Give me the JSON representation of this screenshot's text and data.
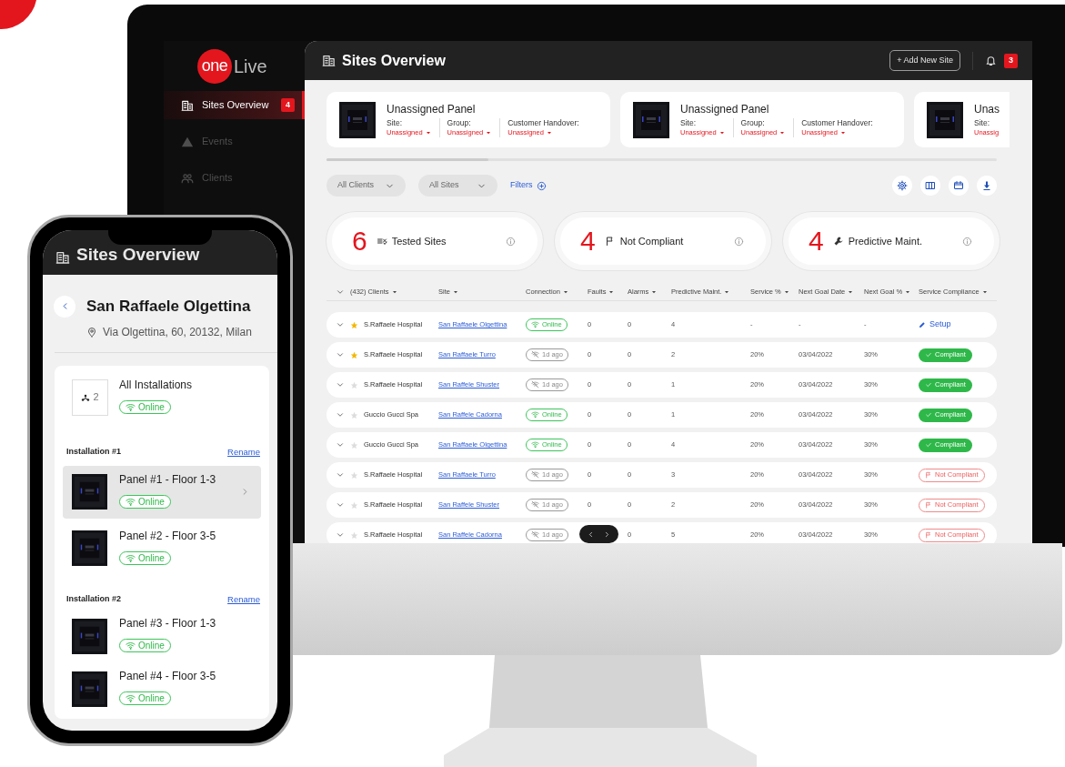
{
  "brand": {
    "logo_badge": "one",
    "logo_text": "Live"
  },
  "sidebar": {
    "items": [
      {
        "label": "Sites Overview",
        "badge": "4",
        "selected": true
      },
      {
        "label": "Events",
        "selected": false
      },
      {
        "label": "Clients",
        "selected": false
      }
    ]
  },
  "header": {
    "title": "Sites Overview",
    "add_button": "+ Add New Site",
    "notification_count": "3"
  },
  "panels": [
    {
      "title": "Unassigned Panel",
      "fields": [
        {
          "label": "Site:",
          "value": "Unassigned",
          "menu": true
        },
        {
          "label": "Group:",
          "value": "Unassigned",
          "menu": true
        },
        {
          "label": "Customer Handover:",
          "value": "Unassigned",
          "menu": true
        }
      ]
    },
    {
      "title": "Unassigned Panel",
      "fields": [
        {
          "label": "Site:",
          "value": "Unassigned",
          "menu": true
        },
        {
          "label": "Group:",
          "value": "Unassigned",
          "menu": true
        },
        {
          "label": "Customer Handover:",
          "value": "Unassigned",
          "menu": true
        }
      ]
    },
    {
      "title": "Unas",
      "fields": [
        {
          "label": "Site:",
          "value": "Unassig",
          "menu": false
        }
      ]
    }
  ],
  "filters": {
    "dropdowns": [
      "All Clients",
      "All Sites"
    ],
    "filters_link": "Filters"
  },
  "stats": [
    {
      "value": "6",
      "label": "Tested Sites",
      "kind": "tested"
    },
    {
      "value": "4",
      "label": "Not Compliant",
      "kind": "flag"
    },
    {
      "value": "4",
      "label": "Predictive Maint.",
      "kind": "wrench"
    }
  ],
  "table": {
    "columns": [
      "(432) Clients",
      "Site",
      "Connection",
      "Faults",
      "Alarms",
      "Predictive Maint.",
      "Service %",
      "Next Goal Date",
      "Next Goal %",
      "Service Compliance"
    ],
    "rows": [
      {
        "starred": true,
        "client": "S.Raffaele Hospital",
        "site": "San Raffaele Olgettina",
        "connection": {
          "online": true,
          "text": "Online"
        },
        "faults": "0",
        "alarms": "0",
        "predictive": "4",
        "service": "-",
        "goal_date": "-",
        "goal_pct": "-",
        "compliance": {
          "kind": "setup",
          "text": "Setup"
        }
      },
      {
        "starred": true,
        "client": "S.Raffaele Hospital",
        "site": "San Raffaele Turro",
        "connection": {
          "online": false,
          "text": "1d ago"
        },
        "faults": "0",
        "alarms": "0",
        "predictive": "2",
        "service": "20%",
        "goal_date": "03/04/2022",
        "goal_pct": "30%",
        "compliance": {
          "kind": "compliant",
          "text": "Compliant"
        }
      },
      {
        "starred": false,
        "client": "S.Raffaele Hospital",
        "site": "San Raffele Shuster",
        "connection": {
          "online": false,
          "text": "1d ago"
        },
        "faults": "0",
        "alarms": "0",
        "predictive": "1",
        "service": "20%",
        "goal_date": "03/04/2022",
        "goal_pct": "30%",
        "compliance": {
          "kind": "compliant",
          "text": "Compliant"
        }
      },
      {
        "starred": false,
        "client": "Guccio Gucci Spa",
        "site": "San Raffele Cadorna",
        "connection": {
          "online": true,
          "text": "Online"
        },
        "faults": "0",
        "alarms": "0",
        "predictive": "1",
        "service": "20%",
        "goal_date": "03/04/2022",
        "goal_pct": "30%",
        "compliance": {
          "kind": "compliant",
          "text": "Compliant"
        }
      },
      {
        "starred": false,
        "client": "Guccio Gucci Spa",
        "site": "San Raffaele Olgettina",
        "connection": {
          "online": true,
          "text": "Online"
        },
        "faults": "0",
        "alarms": "0",
        "predictive": "4",
        "service": "20%",
        "goal_date": "03/04/2022",
        "goal_pct": "30%",
        "compliance": {
          "kind": "compliant",
          "text": "Compliant"
        }
      },
      {
        "starred": false,
        "client": "S.Raffaele Hospital",
        "site": "San Raffaele Turro",
        "connection": {
          "online": false,
          "text": "1d ago"
        },
        "faults": "0",
        "alarms": "0",
        "predictive": "3",
        "service": "20%",
        "goal_date": "03/04/2022",
        "goal_pct": "30%",
        "compliance": {
          "kind": "not_compliant",
          "text": "Not Compliant"
        }
      },
      {
        "starred": false,
        "client": "S.Raffaele Hospital",
        "site": "San Raffele Shuster",
        "connection": {
          "online": false,
          "text": "1d ago"
        },
        "faults": "0",
        "alarms": "0",
        "predictive": "2",
        "service": "20%",
        "goal_date": "03/04/2022",
        "goal_pct": "30%",
        "compliance": {
          "kind": "not_compliant",
          "text": "Not Compliant"
        }
      },
      {
        "starred": false,
        "client": "S.Raffaele Hospital",
        "site": "San Raffele Cadorna",
        "connection": {
          "online": false,
          "text": "1d ago"
        },
        "alarms": "0",
        "predictive": "5",
        "service": "20%",
        "goal_date": "03/04/2022",
        "goal_pct": "30%",
        "compliance": {
          "kind": "not_compliant",
          "text": "Not Compliant"
        }
      }
    ]
  },
  "mobile": {
    "header_title": "Sites Overview",
    "site_name": "San Raffaele Olgettina",
    "address": "Via Olgettina, 60, 20132, Milan",
    "summary": {
      "label": "All Installations",
      "count": "2",
      "status": "Online"
    },
    "installations": [
      {
        "title": "Installation #1",
        "action": "Rename",
        "panels": [
          {
            "name": "Panel #1 - Floor 1-3",
            "status": "Online",
            "selected": true
          },
          {
            "name": "Panel #2 - Floor 3-5",
            "status": "Online",
            "selected": false
          }
        ]
      },
      {
        "title": "Installation #2",
        "action": "Rename",
        "panels": [
          {
            "name": "Panel #3 - Floor 1-3",
            "status": "Online",
            "selected": false
          },
          {
            "name": "Panel #4 - Floor 3-5",
            "status": "Online",
            "selected": false
          }
        ]
      }
    ]
  }
}
